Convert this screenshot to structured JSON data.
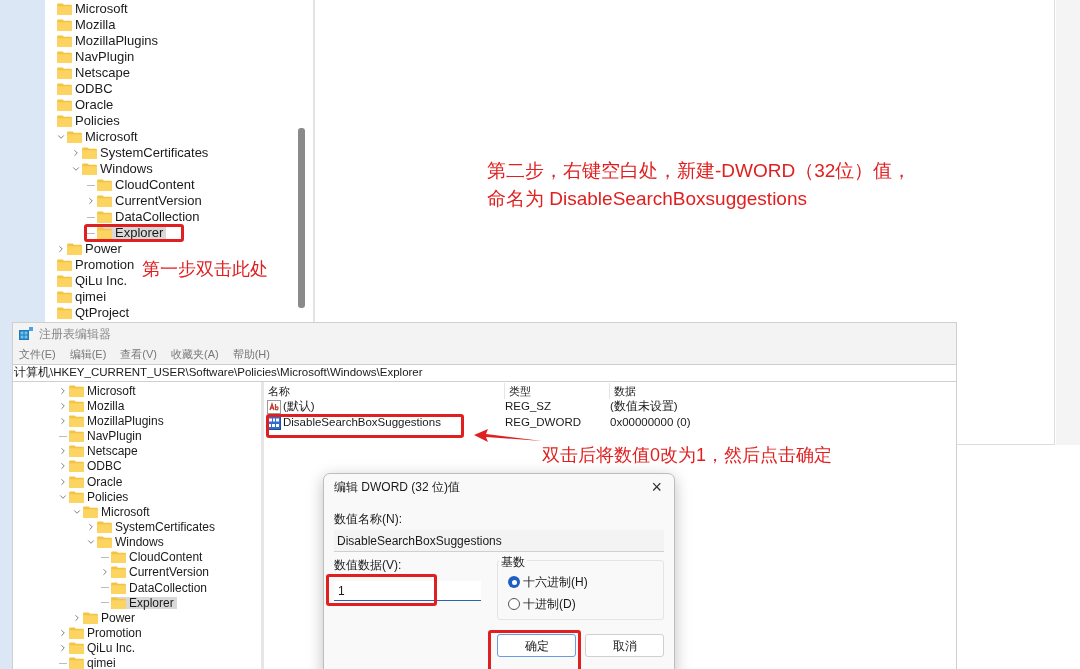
{
  "background_editor": {
    "tree": [
      {
        "label": "Microsoft",
        "selected": false
      },
      {
        "label": "Mozilla",
        "selected": false
      },
      {
        "label": "MozillaPlugins",
        "selected": false
      },
      {
        "label": "NavPlugin",
        "selected": false
      },
      {
        "label": "Netscape",
        "selected": false
      },
      {
        "label": "ODBC",
        "selected": false
      },
      {
        "label": "Oracle",
        "selected": false
      },
      {
        "label": "Policies",
        "selected": false,
        "children": [
          {
            "label": "Microsoft",
            "expanded": true,
            "selected": false,
            "children": [
              {
                "label": "SystemCertificates",
                "expanded": false,
                "selected": false
              },
              {
                "label": "Windows",
                "expanded": true,
                "selected": false,
                "children": [
                  {
                    "label": "CloudContent",
                    "selected": false
                  },
                  {
                    "label": "CurrentVersion",
                    "expanded": false,
                    "selected": false
                  },
                  {
                    "label": "DataCollection",
                    "selected": false
                  },
                  {
                    "label": "Explorer",
                    "selected": true
                  }
                ]
              }
            ]
          },
          {
            "label": "Power",
            "expanded": false,
            "selected": false
          }
        ]
      },
      {
        "label": "Promotion",
        "selected": false
      },
      {
        "label": "QiLu Inc.",
        "selected": false
      },
      {
        "label": "qimei",
        "selected": false
      },
      {
        "label": "QtProject",
        "selected": false
      }
    ]
  },
  "step_notes": [
    {
      "lines": [
        "第一步双击此处"
      ]
    },
    {
      "lines": [
        "第二步，右键空白处，新建-DWORD（32位）值，",
        "命名为 DisableSearchBoxsuggestions"
      ]
    },
    {
      "lines": [
        "双击后将数值0改为1，然后点击确定"
      ]
    }
  ],
  "registry_editor": {
    "title": "注册表编辑器",
    "menu": [
      "文件(E)",
      "编辑(E)",
      "查看(V)",
      "收藏夹(A)",
      "帮助(H)"
    ],
    "address": "计算机\\HKEY_CURRENT_USER\\Software\\Policies\\Microsoft\\Windows\\Explorer",
    "tree": [
      {
        "label": "Microsoft",
        "expanded": false,
        "selected": false
      },
      {
        "label": "Mozilla",
        "expanded": false,
        "selected": false
      },
      {
        "label": "MozillaPlugins",
        "expanded": false,
        "selected": false
      },
      {
        "label": "NavPlugin",
        "selected": false
      },
      {
        "label": "Netscape",
        "expanded": false,
        "selected": false
      },
      {
        "label": "ODBC",
        "expanded": false,
        "selected": false
      },
      {
        "label": "Oracle",
        "expanded": false,
        "selected": false
      },
      {
        "label": "Policies",
        "expanded": true,
        "selected": false,
        "children": [
          {
            "label": "Microsoft",
            "expanded": true,
            "selected": false,
            "children": [
              {
                "label": "SystemCertificates",
                "expanded": false,
                "selected": false
              },
              {
                "label": "Windows",
                "expanded": true,
                "selected": false,
                "children": [
                  {
                    "label": "CloudContent",
                    "selected": false
                  },
                  {
                    "label": "CurrentVersion",
                    "expanded": false,
                    "selected": false
                  },
                  {
                    "label": "DataCollection",
                    "selected": false
                  },
                  {
                    "label": "Explorer",
                    "selected": true
                  }
                ]
              }
            ]
          },
          {
            "label": "Power",
            "expanded": false,
            "selected": false
          }
        ]
      },
      {
        "label": "Promotion",
        "expanded": false,
        "selected": false
      },
      {
        "label": "QiLu Inc.",
        "expanded": false,
        "selected": false
      },
      {
        "label": "qimei",
        "selected": false
      }
    ],
    "list": {
      "columns": [
        "名称",
        "类型",
        "数据"
      ],
      "rows": [
        {
          "kind": "string",
          "name": "(默认)",
          "type": "REG_SZ",
          "data": "(数值未设置)"
        },
        {
          "kind": "dword",
          "name": "DisableSearchBoxSuggestions",
          "type": "REG_DWORD",
          "data": "0x00000000 (0)"
        }
      ]
    }
  },
  "dialog": {
    "title": "编辑 DWORD (32 位)值",
    "close": "×",
    "name_label": "数值名称(N):",
    "name_value": "DisableSearchBoxSuggestions",
    "data_label": "数值数据(V):",
    "data_value": "1",
    "base_label": "基数",
    "bases": [
      {
        "label": "十六进制(H)",
        "selected": true
      },
      {
        "label": "十进制(D)",
        "selected": false
      }
    ],
    "buttons": [
      "确定",
      "取消"
    ]
  }
}
